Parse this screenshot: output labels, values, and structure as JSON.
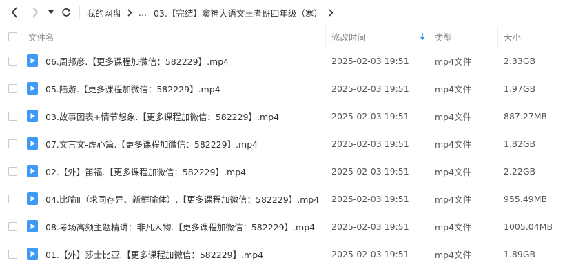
{
  "toolbar": {
    "breadcrumbs": [
      "我的网盘",
      "...",
      "03.【完结】窦神大语文王者班四年级（寒）"
    ]
  },
  "columns": {
    "name": "文件名",
    "modified": "修改时间",
    "type": "类型",
    "size": "大小"
  },
  "colors": {
    "accent": "#2f8cf0",
    "file_icon": "#3d9af7"
  },
  "files": [
    {
      "name": "06.周邦彦.【更多课程加微信：582229】.mp4",
      "modified": "2025-02-03 19:51",
      "type": "mp4文件",
      "size": "2.33GB"
    },
    {
      "name": "05.陆游.【更多课程加微信：582229】.mp4",
      "modified": "2025-02-03 19:51",
      "type": "mp4文件",
      "size": "1.97GB"
    },
    {
      "name": "03.故事图表+情节想象.【更多课程加微信：582229】.mp4",
      "modified": "2025-02-03 19:51",
      "type": "mp4文件",
      "size": "887.27MB"
    },
    {
      "name": "07.文言文-虚心篇.【更多课程加微信：582229】.mp4",
      "modified": "2025-02-03 19:51",
      "type": "mp4文件",
      "size": "1.82GB"
    },
    {
      "name": "02.【外】笛福.【更多课程加微信：582229】.mp4",
      "modified": "2025-02-03 19:51",
      "type": "mp4文件",
      "size": "2.22GB"
    },
    {
      "name": "04.比喻Ⅱ（求同存异、新鲜喻体）.【更多课程加微信：582229】.mp4",
      "modified": "2025-02-03 19:51",
      "type": "mp4文件",
      "size": "955.49MB"
    },
    {
      "name": "08.考场高频主题精讲：非凡人物.【更多课程加微信：582229】.mp4",
      "modified": "2025-02-03 19:51",
      "type": "mp4文件",
      "size": "1005.04MB"
    },
    {
      "name": "01.【外】莎士比亚.【更多课程加微信：582229】.mp4",
      "modified": "2025-02-03 19:51",
      "type": "mp4文件",
      "size": "1.89GB"
    }
  ]
}
